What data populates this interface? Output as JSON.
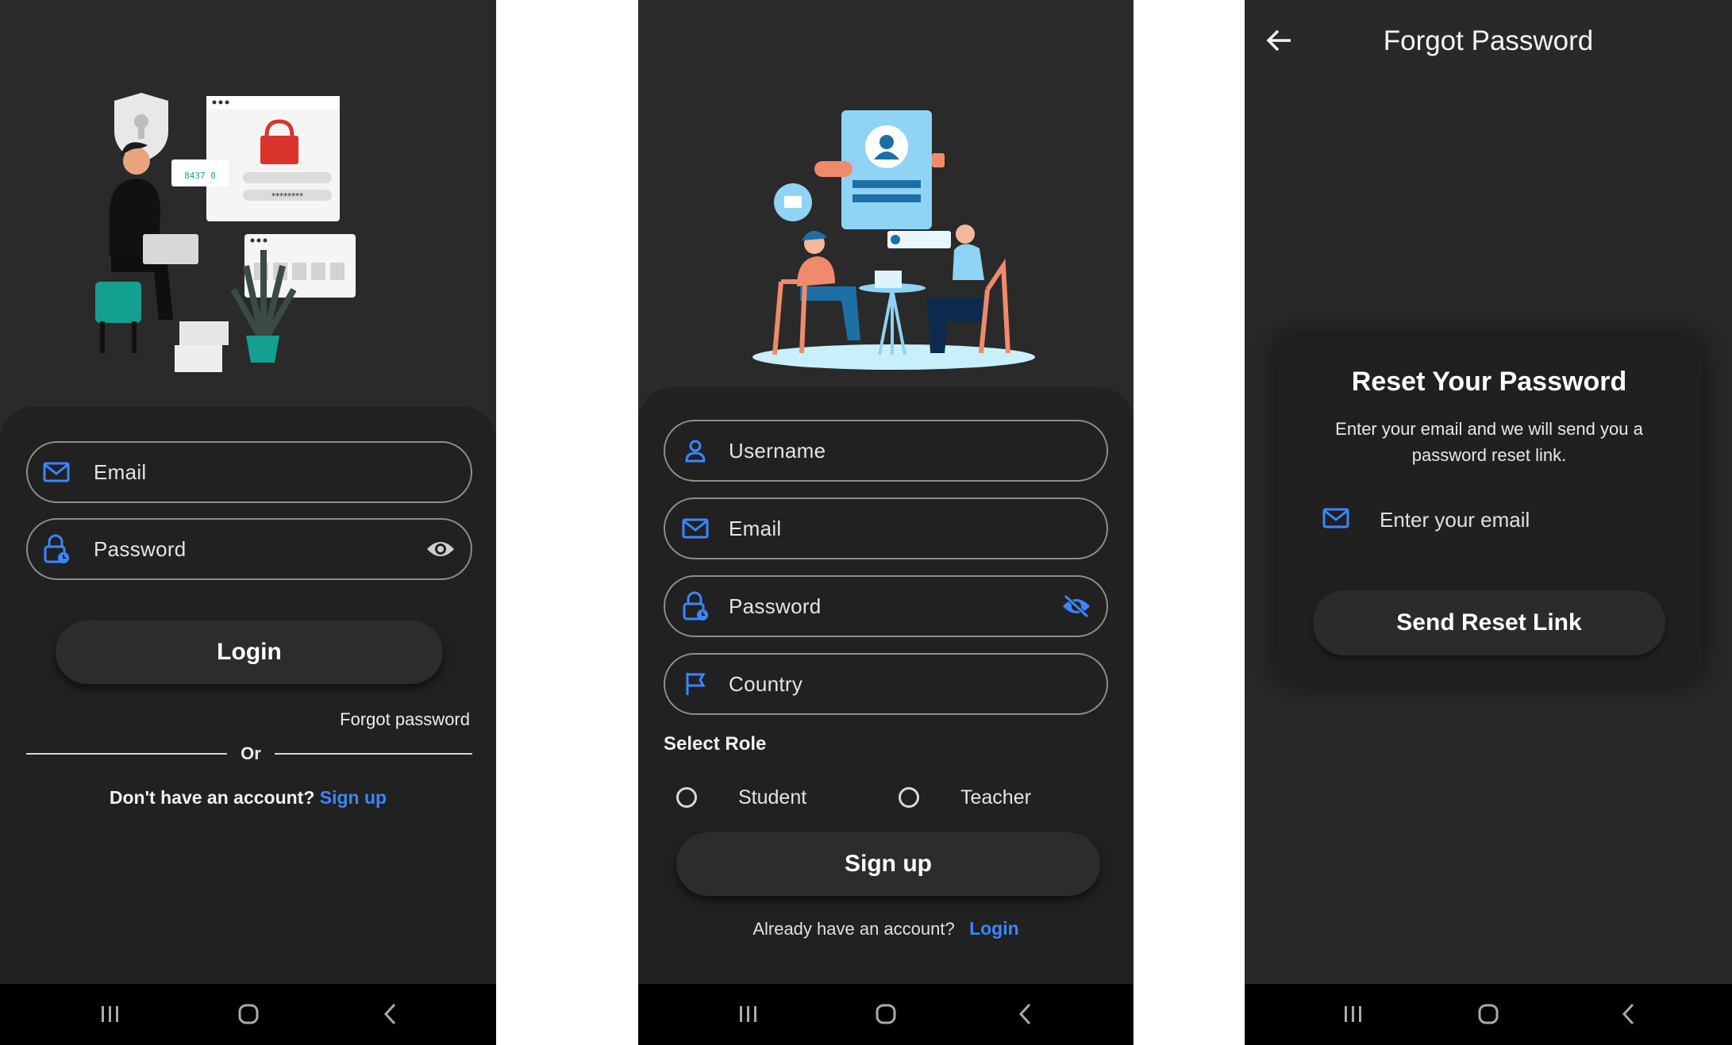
{
  "login_screen": {
    "email_placeholder": "Email",
    "password_placeholder": "Password",
    "login_button": "Login",
    "forgot_password": "Forgot password",
    "or_divider": "Or",
    "no_account_text": "Don't have an account?",
    "sign_up_link": "Sign up"
  },
  "signup_screen": {
    "username_placeholder": "Username",
    "email_placeholder": "Email",
    "password_placeholder": "Password",
    "country_placeholder": "Country",
    "select_role_label": "Select Role",
    "role_options": [
      "Student",
      "Teacher"
    ],
    "sign_up_button": "Sign up",
    "have_account_text": "Already have an account?",
    "login_link": "Login"
  },
  "forgot_screen": {
    "app_bar_title": "Forgot Password",
    "card_title": "Reset Your Password",
    "card_subtitle": "Enter your email and we will send you a password reset link.",
    "email_placeholder": "Enter your email",
    "send_button": "Send Reset Link"
  },
  "colors": {
    "background": "#2a2a2a",
    "sheet": "#212121",
    "accent_blue": "#3b86ff",
    "field_border": "#8e8e8e",
    "nav_bar": "#000000"
  },
  "icons": {
    "email": "mail-icon",
    "password": "lock-clock-icon",
    "visibility": "eye-icon",
    "visibility_off": "eye-off-icon",
    "username": "person-icon",
    "country": "flag-icon",
    "back": "arrow-left-icon",
    "nav": [
      "recent-apps-icon",
      "home-icon",
      "back-chevron-icon"
    ]
  }
}
